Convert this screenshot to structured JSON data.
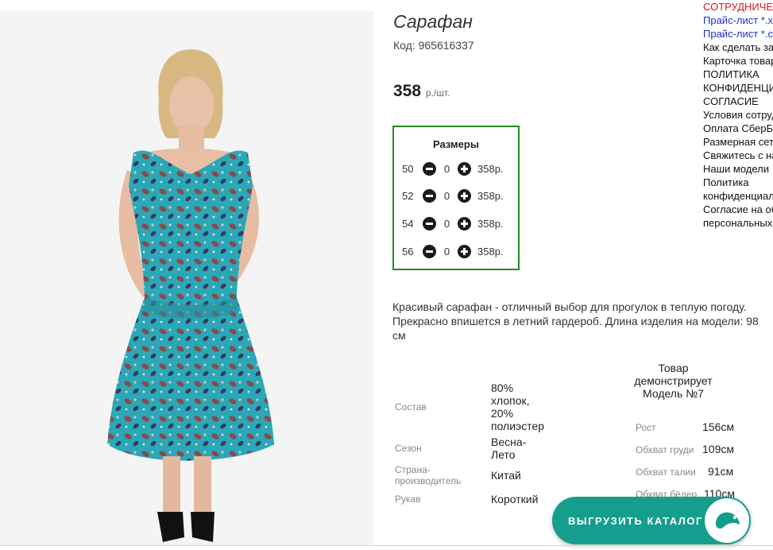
{
  "product": {
    "title": "Сарафан",
    "code_label": "Код: 965616337",
    "price": "358",
    "price_unit": "р./шт."
  },
  "sizes": {
    "header": "Размеры",
    "rows": [
      {
        "size": "50",
        "qty": "0",
        "price": "358р."
      },
      {
        "size": "52",
        "qty": "0",
        "price": "358р."
      },
      {
        "size": "54",
        "qty": "0",
        "price": "358р."
      },
      {
        "size": "56",
        "qty": "0",
        "price": "358р."
      }
    ]
  },
  "description": "Красивый сарафан - отличный выбор для прогулок в теплую погоду. Прекрасно впишется в летний гардероб. Длина изделия на модели: 98 см",
  "specs": [
    {
      "key": "Состав",
      "value": "80% хлопок, 20% полиэстер"
    },
    {
      "key": "Сезон",
      "value": "Весна-Лето"
    },
    {
      "key": "Страна-производитель",
      "value": "Китай"
    },
    {
      "key": "Рукав",
      "value": "Короткий"
    }
  ],
  "model": {
    "header": "Товар демонстрирует Модель №7",
    "params": [
      {
        "key": "Рост",
        "value": "156см"
      },
      {
        "key": "Обхват груди",
        "value": "109см"
      },
      {
        "key": "Обхват талии",
        "value": "91см"
      },
      {
        "key": "Обхват бёдер",
        "value": "110см"
      }
    ]
  },
  "sidebar": {
    "lines": [
      "СОТРУДНИЧЕСТВО",
      "Прайс-лист *.xls",
      "Прайс-лист *.csv",
      "Как сделать заказ",
      "Карточка товара",
      "ПОЛИТИКА",
      "КОНФИДЕНЦИАЛЬНОСТИ",
      "СОГЛАСИЕ",
      "Условия сотрудничества",
      "Оплата СберБанк",
      "Размерная сетка",
      "Свяжитесь с нами",
      "Наши модели",
      "Политика",
      "конфиденциальности",
      "Согласие на обработку",
      "персональных данных"
    ]
  },
  "export_button": {
    "label": "ВЫГРУЗИТЬ КАТАЛОГ"
  },
  "icons": {
    "export_icon": "brand-logo-icon",
    "minus": "minus-circle-icon",
    "plus": "plus-circle-icon"
  },
  "colors": {
    "sizes_border": "#1e8c1e",
    "export_bg": "#159e8d",
    "sidebar_red": "#d81b1b",
    "sidebar_blue": "#1a2fd0"
  }
}
